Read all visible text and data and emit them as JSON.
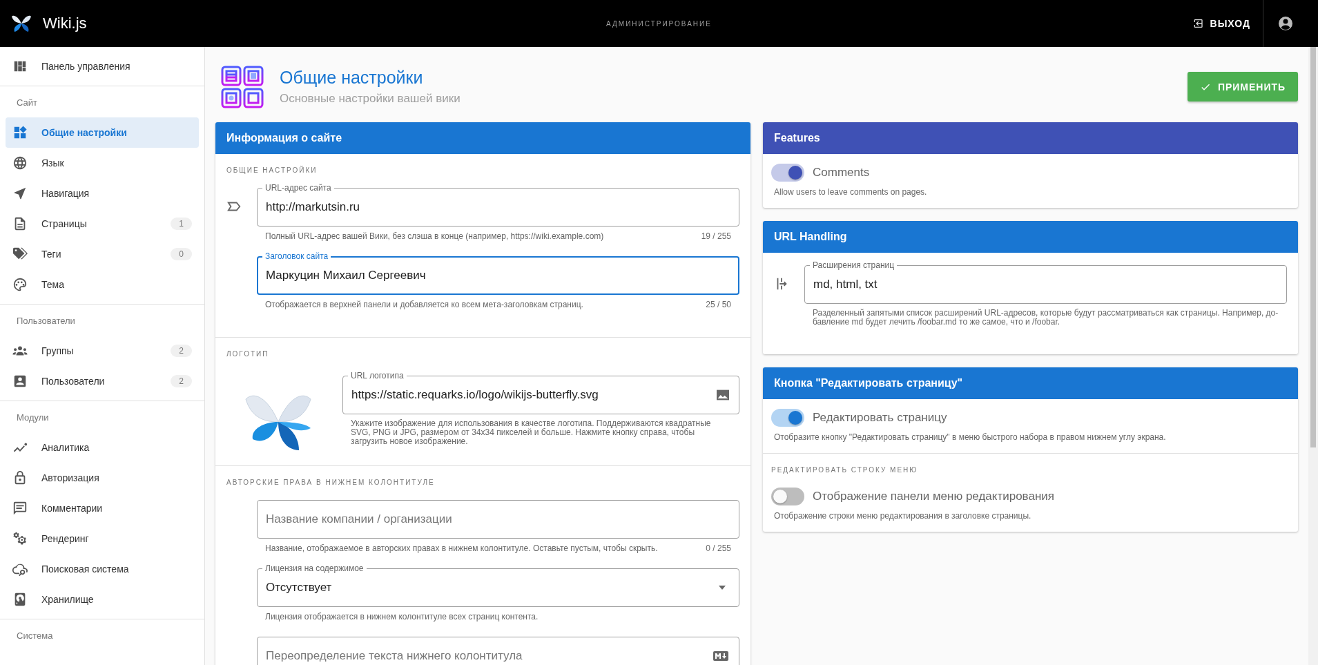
{
  "topbar": {
    "logo_text": "Wiki.js",
    "center_title": "АДМИНИСТРИРОВАНИЕ",
    "logout": "ВЫХОД"
  },
  "sidebar": {
    "items": [
      {
        "kind": "item",
        "label": "Панель управления",
        "selected": false
      },
      {
        "kind": "header",
        "label": "Сайт"
      },
      {
        "kind": "item",
        "label": "Общие настройки",
        "selected": true
      },
      {
        "kind": "item",
        "label": "Язык",
        "selected": false
      },
      {
        "kind": "item",
        "label": "Навигация",
        "selected": false
      },
      {
        "kind": "item",
        "label": "Страницы",
        "selected": false,
        "badge": "1"
      },
      {
        "kind": "item",
        "label": "Теги",
        "selected": false,
        "badge": "0"
      },
      {
        "kind": "item",
        "label": "Тема",
        "selected": false
      },
      {
        "kind": "header",
        "label": "Пользователи"
      },
      {
        "kind": "item",
        "label": "Группы",
        "selected": false,
        "badge": "2"
      },
      {
        "kind": "item",
        "label": "Пользователи",
        "selected": false,
        "badge": "2"
      },
      {
        "kind": "header",
        "label": "Модули"
      },
      {
        "kind": "item",
        "label": "Аналитика",
        "selected": false
      },
      {
        "kind": "item",
        "label": "Авторизация",
        "selected": false
      },
      {
        "kind": "item",
        "label": "Комментарии",
        "selected": false
      },
      {
        "kind": "item",
        "label": "Рендеринг",
        "selected": false
      },
      {
        "kind": "item",
        "label": "Поисковая система",
        "selected": false
      },
      {
        "kind": "item",
        "label": "Хранилище",
        "selected": false
      },
      {
        "kind": "header",
        "label": "Система"
      }
    ]
  },
  "page_header": {
    "title": "Общие настройки",
    "subtitle": "Основные настройки вашей вики",
    "apply_button": "ПРИМЕНИТЬ"
  },
  "site_info": {
    "title": "Информация о сайте",
    "sections": [
      {
        "kind": "fields",
        "heading": "ОБЩИЕ НАСТРОЙКИ",
        "fields": [
          {
            "kind": "text",
            "label": "URL-адрес сайта",
            "value": "http://markutsin.ru",
            "hint": "Полный URL-адрес вашей Вики, без слэша в конце (например, https://wiki.example.com)",
            "counter": "19 / 255",
            "focused": false
          },
          {
            "kind": "text",
            "label": "Заголовок сайта",
            "value": "Маркуцин Михаил Сергеевич",
            "hint": "Отображается в верхней панели и добавляется ко всем мета-заголовкам страниц.",
            "counter": "25 / 50",
            "focused": true
          }
        ]
      },
      {
        "kind": "logo",
        "heading": "ЛОГОТИП",
        "fields": [
          {
            "kind": "image",
            "label": "URL логотипа",
            "value": "https://static.requarks.io/logo/wikijs-butterfly.svg",
            "hint": "Укажите изображение для использования в качестве логотипа. Поддерживаются квадратные SVG, PNG и JPG, размером от 34x34 пикселей и больше. Нажмите кнопку справа, чтобы загрузить новое изображение.",
            "focused": false
          }
        ]
      },
      {
        "kind": "fields",
        "heading": "АВТОРСКИЕ ПРАВА В НИЖНЕМ КОЛОНТИТУЛЕ",
        "fields": [
          {
            "kind": "text",
            "placeholder": "Название компании / организации",
            "hint": "Название, отображаемое в авторских правах в нижнем колонтитуле. Оставьте пустым, чтобы скрыть.",
            "counter": "0 / 255",
            "focused": false
          },
          {
            "kind": "select",
            "label": "Лицензия на содержимое",
            "value": "Отсутствует",
            "hint": "Лицензия отображается в нижнем колонтитуле всех страниц контента.",
            "focused": false
          },
          {
            "kind": "markdown",
            "placeholder": "Переопределение текста нижнего колонтитула",
            "focused": false
          }
        ]
      }
    ]
  },
  "features": {
    "title": "Features",
    "toggles": [
      {
        "label": "Comments",
        "on": true,
        "hint": "Allow users to leave comments on pages."
      }
    ]
  },
  "url_handling": {
    "title": "URL Handling",
    "field": {
      "label": "Расширения страниц",
      "value": "md, html, txt",
      "hint": "Разделенный запятыми список расширений URL-адресов, которые будут рассматриваться как страницы. Например, до-бавление md будет лечить /foobar.md то же самое, что и /foobar."
    }
  },
  "edit_button": {
    "title": "Кнопка \"Редактировать страницу\"",
    "toggles": [
      {
        "label": "Редактировать страницу",
        "on": true,
        "hint": "Отобразите кнопку \"Редактировать страницу\" в меню быстрого набора в правом нижнем углу экрана."
      }
    ],
    "section_heading": "РЕДАКТИРОВАТЬ СТРОКУ МЕНЮ",
    "section_toggles": [
      {
        "label": "Отображение панели меню редактирования",
        "on": false,
        "hint": "Отображение строки меню редактирования в заголовке страницы."
      }
    ]
  }
}
